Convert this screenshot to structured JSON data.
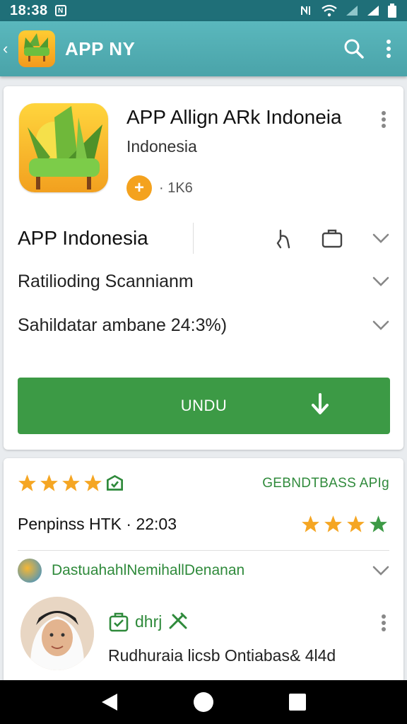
{
  "status_bar": {
    "time": "18:38",
    "left_icon": "N"
  },
  "app_bar": {
    "title": "APP NY"
  },
  "app_card": {
    "name": "APP Allign ARk Indoneia",
    "publisher": "Indonesia",
    "badge_symbol": "+",
    "badge_count": "· 1K6"
  },
  "rows": [
    {
      "label": "APP Indonesia"
    },
    {
      "label": "Ratilioding Scannianm"
    },
    {
      "label": "Sahildatar ambane 24:3%)"
    }
  ],
  "install_button": {
    "label": "UNDU"
  },
  "review_section": {
    "rating": 4,
    "link_label": "GEBNDTBASS APIg",
    "meta": "Penpinss HTK · 22:03",
    "review_rating": 4,
    "developer_label": "DastuahahlNemihallDenanan",
    "user_name": "dhrj",
    "review_text": "Rudhuraia licsb Ontiabas& 4l4d"
  },
  "colors": {
    "primary": "#4aa3a9",
    "accent_green": "#3c9a45",
    "star_yellow": "#f5a623",
    "status_bar": "#1f6f78"
  }
}
